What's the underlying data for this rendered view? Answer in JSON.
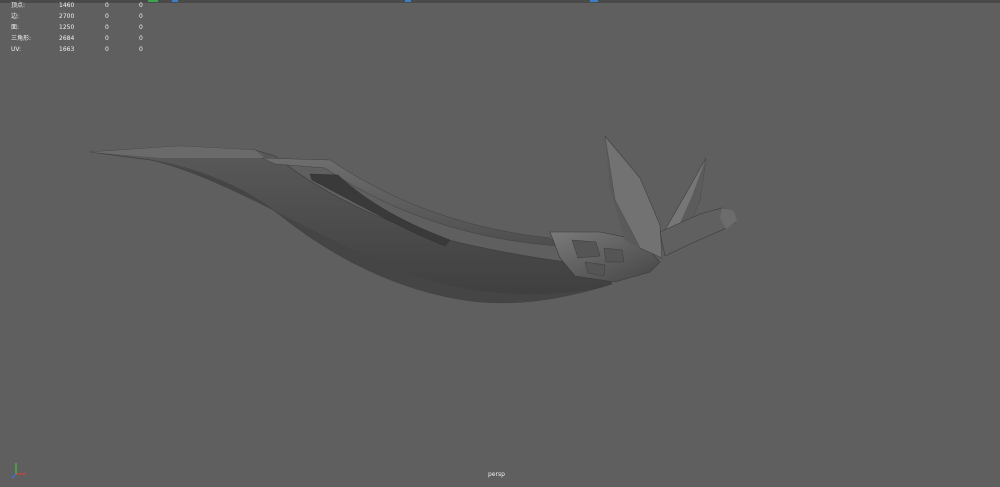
{
  "hud": {
    "rows": [
      {
        "label": "顶点:",
        "v1": "1460",
        "v2": "0",
        "v3": "0"
      },
      {
        "label": "边:",
        "v1": "2700",
        "v2": "0",
        "v3": "0"
      },
      {
        "label": "面:",
        "v1": "1250",
        "v2": "0",
        "v3": "0"
      },
      {
        "label": "三角形:",
        "v1": "2684",
        "v2": "0",
        "v3": "0"
      },
      {
        "label": "UV:",
        "v1": "1663",
        "v2": "0",
        "v3": "0"
      }
    ]
  },
  "viewport": {
    "camera_label": "persp",
    "background_color": "#5f5f5f"
  },
  "icons": {
    "axis_gizmo": "xyz-axis-icon"
  }
}
